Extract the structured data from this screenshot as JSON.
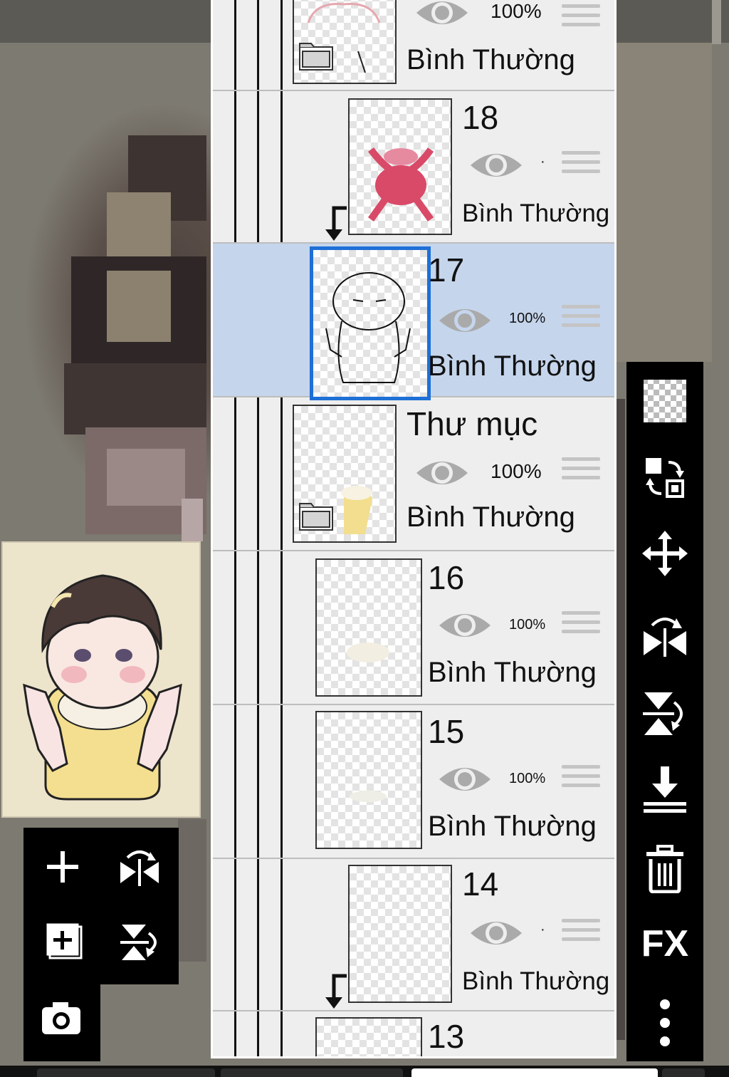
{
  "layers": [
    {
      "name": "",
      "opacity": "100%",
      "blend": "Bình Thường",
      "type": "folder"
    },
    {
      "name": "18",
      "opacity": "·",
      "blend": "Bình Thường",
      "type": "layer",
      "clipped": true
    },
    {
      "name": "17",
      "opacity": "100%",
      "blend": "Bình Thường",
      "type": "layer",
      "selected": true
    },
    {
      "name": "Thư mục",
      "opacity": "100%",
      "blend": "Bình Thường",
      "type": "folder"
    },
    {
      "name": "16",
      "opacity": "100%",
      "blend": "Bình Thường",
      "type": "layer"
    },
    {
      "name": "15",
      "opacity": "100%",
      "blend": "Bình Thường",
      "type": "layer"
    },
    {
      "name": "14",
      "opacity": "·",
      "blend": "Bình Thường",
      "type": "layer",
      "clipped": true
    },
    {
      "name": "13",
      "opacity": "",
      "blend": "",
      "type": "layer"
    }
  ],
  "left_toolbar": {
    "icons": [
      "plus-icon",
      "flip-horizontal-icon",
      "add-layer-icon",
      "flip-vertical-icon",
      "camera-icon"
    ]
  },
  "right_toolbar": {
    "icons": [
      "transparency-icon",
      "swap-icon",
      "move-icon",
      "flip-horizontal-icon",
      "flip-vertical-icon",
      "merge-down-icon",
      "trash-icon",
      "fx-icon",
      "more-icon"
    ],
    "fx_label": "FX"
  },
  "colors": {
    "panel_bg": "#eeeeee",
    "selected_row": "#c5d5ec",
    "selected_border": "#1e6fd6",
    "toolbar_bg": "#000000"
  }
}
